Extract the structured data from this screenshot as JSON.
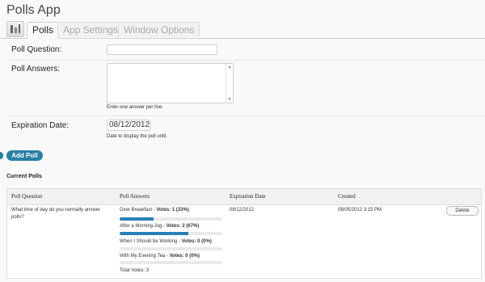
{
  "app": {
    "title": "Polls App",
    "tabs": [
      "Polls",
      "App Settings",
      "Window Options"
    ]
  },
  "form": {
    "poll_question_label": "Poll Question:",
    "poll_answers_label": "Poll Answers:",
    "answers_help": "Enter one answer per line.",
    "expiration_label": "Expiration Date:",
    "expiration_value": "08/12/2012",
    "expiration_help": "Date to display the poll until.",
    "add_button": "Add Poll"
  },
  "current_polls": {
    "title": "Current Polls",
    "headers": [
      "Poll Question",
      "Poll Answers",
      "Expiration Date",
      "Created"
    ],
    "row": {
      "question": "What time of day do you normally answer polls?",
      "answers": [
        {
          "name": "Over Breakfast",
          "votes_text": "Votes: 1 (33%)",
          "fraction": 0.33
        },
        {
          "name": "After a Morning Jog",
          "votes_text": "Votes: 2 (67%)",
          "fraction": 0.67
        },
        {
          "name": "When I Should be Working",
          "votes_text": "Votes: 0 (0%)",
          "fraction": 0
        },
        {
          "name": "With My Evening Tea",
          "votes_text": "Votes: 0 (0%)",
          "fraction": 0
        }
      ],
      "total_votes": "Total Votes: 3",
      "expiration": "08/12/2012",
      "created": "08/05/2012 3:15 PM",
      "delete_button": "Delete"
    }
  },
  "colors": {
    "accent": "#2a7fa6",
    "bar_fill": "#2a7fb7"
  }
}
